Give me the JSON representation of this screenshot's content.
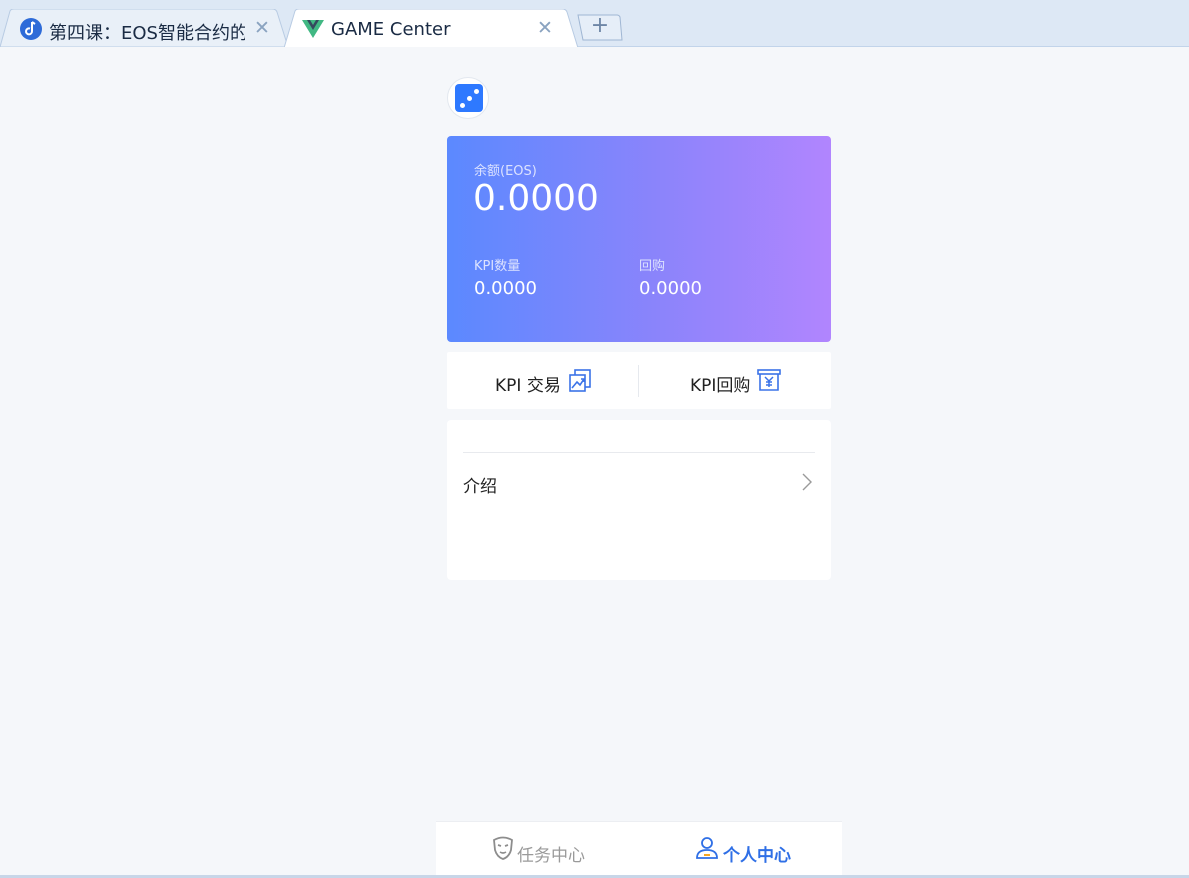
{
  "browser": {
    "tabs": [
      {
        "title": "第四课：EOS智能合约的",
        "close": "✕",
        "favicon": "music-note-icon"
      },
      {
        "title": "GAME Center",
        "close": "✕",
        "favicon": "vue-logo-icon",
        "active": true
      }
    ],
    "new_tab": "+"
  },
  "page": {
    "avatar_icon": "dice-icon",
    "balance": {
      "label": "余额(EOS)",
      "value": "0.0000",
      "kpi_label": "KPI数量",
      "kpi_value": "0.0000",
      "buyback_label": "回购",
      "buyback_value": "0.0000",
      "gradient_start": "#5b89ff",
      "gradient_end": "#b185fe"
    },
    "actions": {
      "trade_label": "KPI 交易",
      "trade_icon": "trade-chart-icon",
      "buyback_label": "KPI回购",
      "buyback_icon": "yen-receipt-icon"
    },
    "info": {
      "intro_label": "介绍",
      "chevron_icon": "chevron-right-icon"
    }
  },
  "bottom_nav": {
    "tasks_label": "任务中心",
    "tasks_icon": "mask-icon",
    "me_label": "个人中心",
    "me_icon": "user-icon",
    "active_color": "#2f6fe6"
  }
}
